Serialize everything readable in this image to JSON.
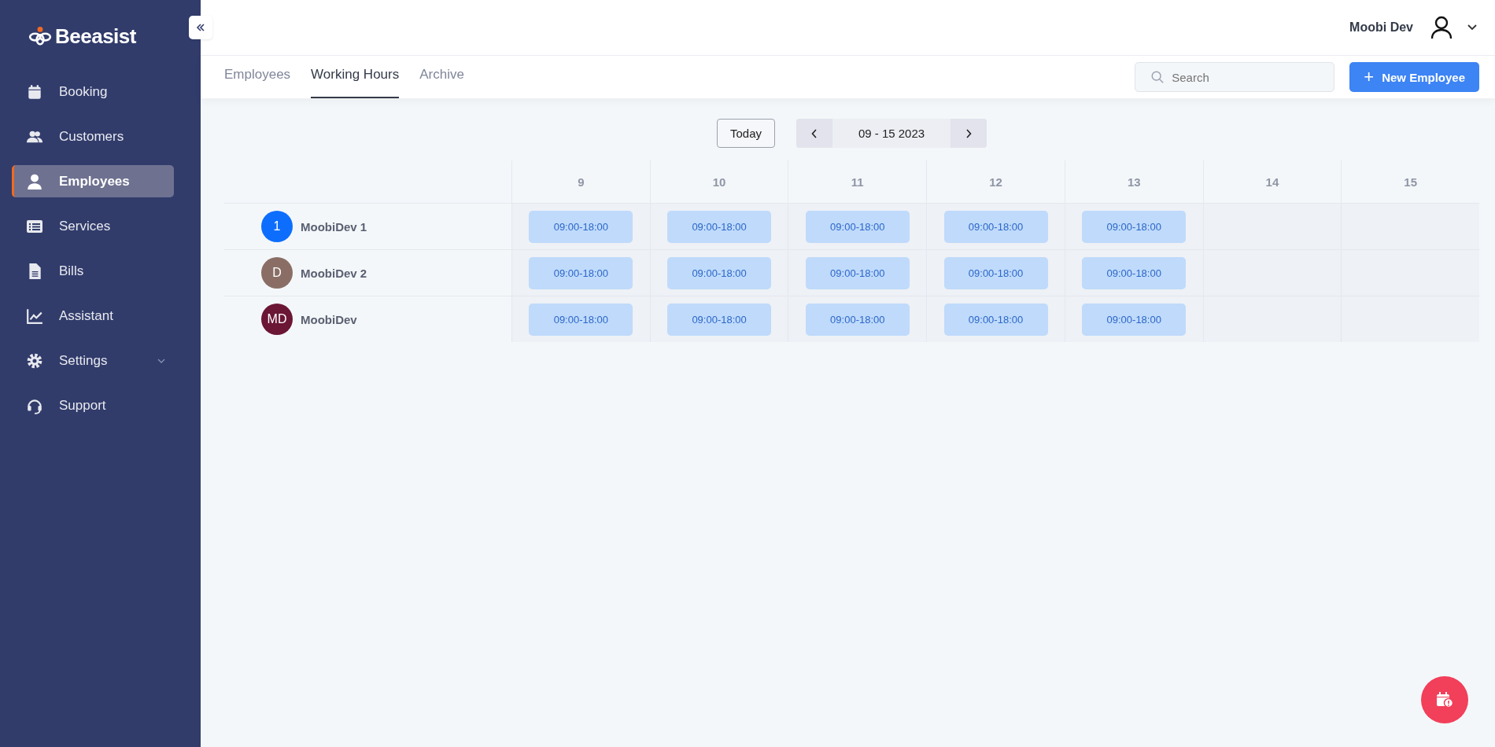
{
  "sidebar": {
    "logo": "Beeasist",
    "items": [
      {
        "label": "Booking",
        "kind": "link",
        "selected": false
      },
      {
        "label": "Customers",
        "kind": "link",
        "selected": false
      },
      {
        "label": "Employees",
        "kind": "link",
        "selected": true
      },
      {
        "label": "Services",
        "kind": "link",
        "selected": false
      },
      {
        "label": "Bills",
        "kind": "link",
        "selected": false
      },
      {
        "label": "Assistant",
        "kind": "link",
        "selected": false
      },
      {
        "label": "Settings",
        "kind": "group",
        "selected": false
      },
      {
        "label": "Support",
        "kind": "link",
        "selected": false
      }
    ]
  },
  "header": {
    "user_name": "Moobi Dev"
  },
  "tabs": [
    {
      "label": "Employees",
      "selected": false
    },
    {
      "label": "Working Hours",
      "selected": true
    },
    {
      "label": "Archive",
      "selected": false
    }
  ],
  "search": {
    "placeholder": "Search"
  },
  "new_button": {
    "icon": "+",
    "label": "New Employee"
  },
  "week_nav": {
    "today": "Today",
    "range": "09 - 15 2023"
  },
  "schedule": {
    "days": [
      "9",
      "10",
      "11",
      "12",
      "13",
      "14",
      "15"
    ],
    "rows": [
      {
        "avatar": "1",
        "name": "MoobiDev 1",
        "color": "#0d6efd",
        "shifts": [
          "09:00-18:00",
          "09:00-18:00",
          "09:00-18:00",
          "09:00-18:00",
          "09:00-18:00"
        ]
      },
      {
        "avatar": "D",
        "name": "MoobiDev 2",
        "color": "#8a6e66",
        "shifts": [
          "09:00-18:00",
          "09:00-18:00",
          "09:00-18:00",
          "09:00-18:00",
          "09:00-18:00"
        ]
      },
      {
        "avatar": "MD",
        "name": "MoobiDev",
        "color": "#6b1634",
        "shifts": [
          "09:00-18:00",
          "09:00-18:00",
          "09:00-18:00",
          "09:00-18:00",
          "09:00-18:00"
        ]
      }
    ]
  }
}
